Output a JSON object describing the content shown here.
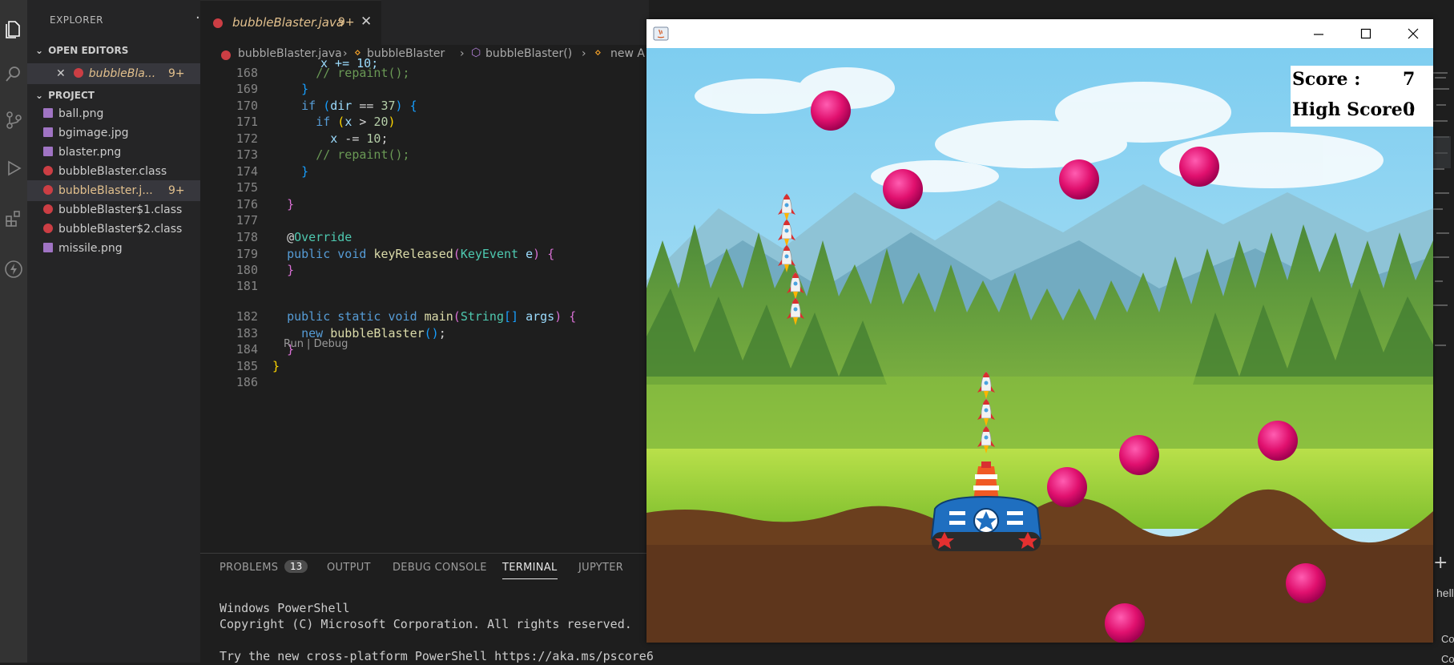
{
  "sidebar": {
    "title": "EXPLORER",
    "more": "···",
    "open_editors": {
      "header": "OPEN EDITORS",
      "items": [
        {
          "name": "bubbleBla...",
          "badge": "9+"
        }
      ]
    },
    "project": {
      "header": "PROJECT",
      "files": [
        {
          "name": "ball.png",
          "type": "image",
          "badge": ""
        },
        {
          "name": "bgimage.jpg",
          "type": "image",
          "badge": ""
        },
        {
          "name": "blaster.png",
          "type": "image",
          "badge": ""
        },
        {
          "name": "bubbleBlaster.class",
          "type": "java",
          "badge": ""
        },
        {
          "name": "bubbleBlaster.j...",
          "type": "java",
          "badge": "9+"
        },
        {
          "name": "bubbleBlaster$1.class",
          "type": "java",
          "badge": ""
        },
        {
          "name": "bubbleBlaster$2.class",
          "type": "java",
          "badge": ""
        },
        {
          "name": "missile.png",
          "type": "image",
          "badge": ""
        }
      ]
    }
  },
  "editor": {
    "tab": {
      "label": "bubbleBlaster.java",
      "badge": "9+"
    },
    "breadcrumb": [
      "bubbleBlaster.java",
      "bubbleBlaster",
      "bubbleBlaster()",
      "new A"
    ],
    "codelens": "Run | Debug",
    "line_numbers": [
      "168",
      "169",
      "170",
      "171",
      "172",
      "173",
      "174",
      "175",
      "176",
      "177",
      "178",
      "179",
      "180",
      "181",
      "182",
      "183",
      "184",
      "185",
      "186"
    ]
  },
  "panel": {
    "tabs": [
      "PROBLEMS",
      "OUTPUT",
      "DEBUG CONSOLE",
      "TERMINAL",
      "JUPYTER"
    ],
    "problems_count": "13",
    "active_tab": "TERMINAL",
    "terminal_lines": [
      "Windows PowerShell",
      "Copyright (C) Microsoft Corporation. All rights reserved.",
      "",
      "Try the new cross-platform PowerShell https://aka.ms/pscore6"
    ]
  },
  "right_edge": {
    "text1": "hell",
    "text2": "Code",
    "text3": "Code"
  },
  "game_window": {
    "title": "",
    "score_label": "Score :",
    "score_value": "7",
    "high_score_label": "High Score :",
    "high_score_value": "0"
  },
  "colors": {
    "accent": "#007acc",
    "ball": "#e0106e",
    "java_icon": "#cc3e44",
    "image_icon": "#a074c4",
    "modified": "#e2c08d"
  }
}
